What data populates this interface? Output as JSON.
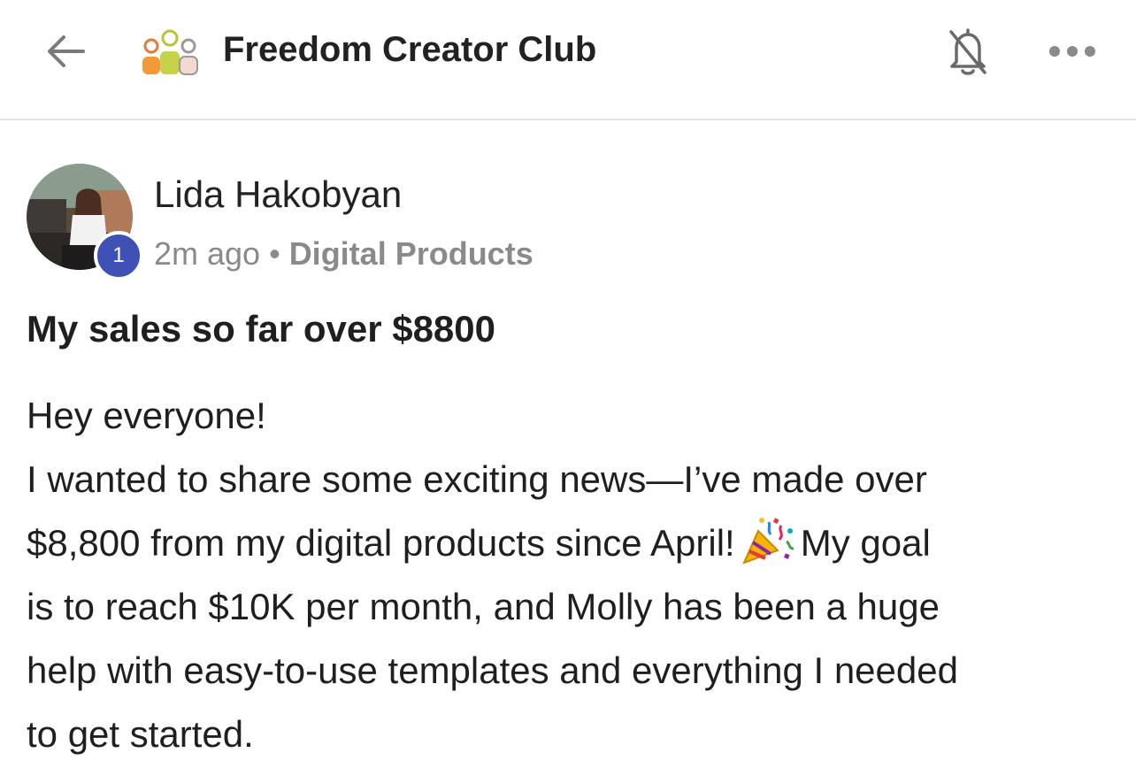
{
  "header": {
    "club_name": "Freedom Creator Club",
    "icons": [
      "back-arrow-icon",
      "group-icon",
      "bell-off-icon",
      "more-icon"
    ]
  },
  "post": {
    "author": "Lida Hakobyan",
    "level": "1",
    "time": "2m ago",
    "separator": "•",
    "category": "Digital Products",
    "title": "My sales so far over $8800",
    "body_lines": [
      "Hey everyone!",
      "I wanted to share some exciting news—I’ve made over",
      "$8,800 from my digital products since April!",
      "My goal",
      "is to reach $10K per month, and Molly has been a huge",
      "help with easy-to-use templates and everything I needed",
      "to get started."
    ],
    "emoji": "party-popper-emoji"
  },
  "colors": {
    "level_badge": "#3f51b5",
    "meta_text": "#8a8a8a",
    "divider": "#e4e4e4"
  }
}
